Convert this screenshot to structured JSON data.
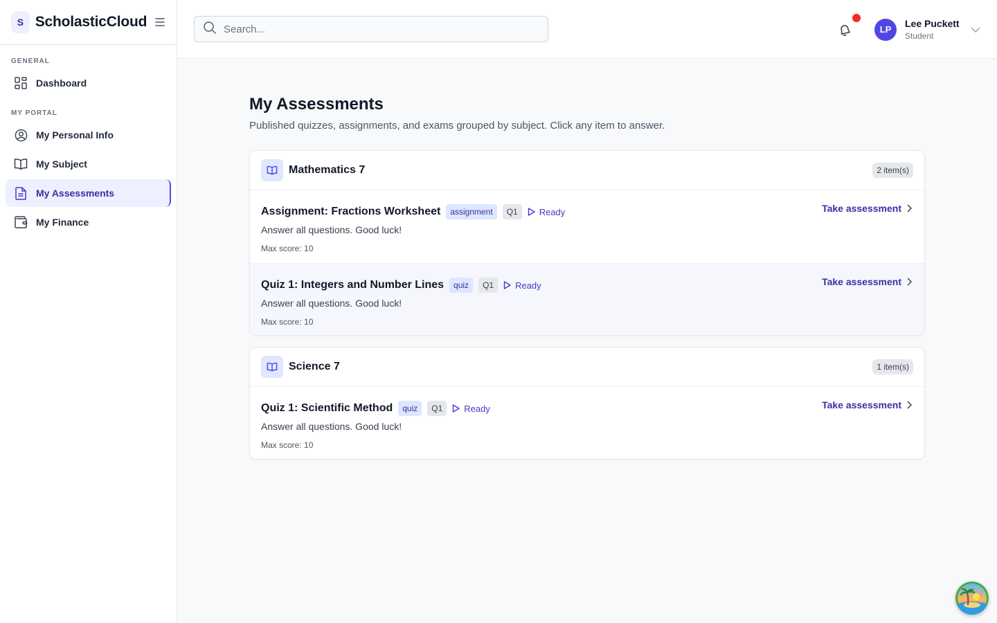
{
  "brand": {
    "logo_letter": "S",
    "name": "ScholasticCloud"
  },
  "sidebar": {
    "sections": [
      {
        "label": "GENERAL"
      },
      {
        "label": "MY PORTAL"
      }
    ],
    "items": [
      {
        "label": "Dashboard",
        "icon": "dashboard-grid-icon"
      },
      {
        "label": "My Personal Info",
        "icon": "user-circle-icon"
      },
      {
        "label": "My Subject",
        "icon": "book-open-icon"
      },
      {
        "label": "My Assessments",
        "icon": "document-icon",
        "active": true
      },
      {
        "label": "My Finance",
        "icon": "wallet-icon"
      }
    ]
  },
  "header": {
    "search_placeholder": "Search...",
    "notifications_unread": true,
    "user": {
      "initials": "LP",
      "name": "Lee Puckett",
      "role": "Student"
    }
  },
  "main": {
    "title": "My Assessments",
    "subtitle": "Published quizzes, assignments, and exams grouped by subject. Click any item to answer.",
    "subjects": [
      {
        "name": "Mathematics 7",
        "count": "2 item(s)",
        "items": [
          {
            "title": "Assignment: Fractions Worksheet",
            "type": "assignment",
            "quarter": "Q1",
            "status": "Ready",
            "description": "Answer all questions. Good luck!",
            "max_score": "Max score: 10",
            "action": "Take assessment"
          },
          {
            "title": "Quiz 1: Integers and Number Lines",
            "type": "quiz",
            "quarter": "Q1",
            "status": "Ready",
            "description": "Answer all questions. Good luck!",
            "max_score": "Max score: 10",
            "action": "Take assessment"
          }
        ]
      },
      {
        "name": "Science 7",
        "count": "1 item(s)",
        "items": [
          {
            "title": "Quiz 1: Scientific Method",
            "type": "quiz",
            "quarter": "Q1",
            "status": "Ready",
            "description": "Answer all questions. Good luck!",
            "max_score": "Max score: 10",
            "action": "Take assessment"
          }
        ]
      }
    ]
  },
  "colors": {
    "accent": "#4f46e5",
    "accent_text": "#3730a3",
    "active_bg": "#eef0ff",
    "notification_dot": "#ef2b2b"
  }
}
